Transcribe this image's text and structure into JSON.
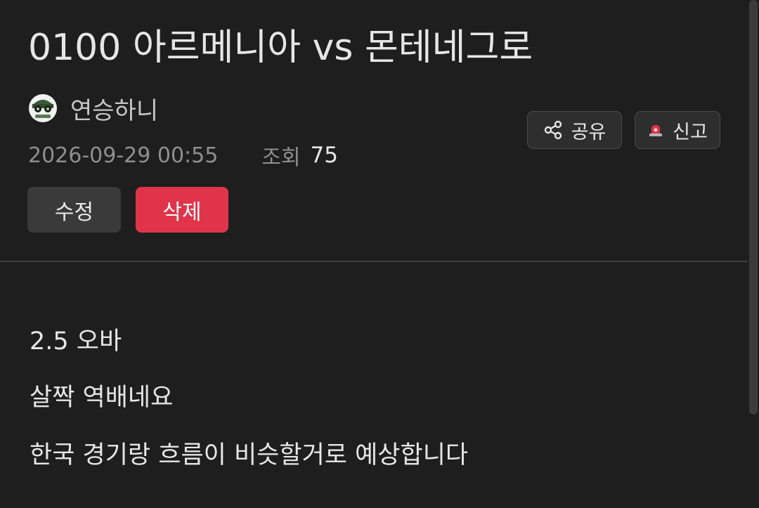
{
  "post": {
    "title": "0100 아르메니아 vs 몬테네그로",
    "author": {
      "name": "연승하니",
      "avatar_icon": "avatar-icon"
    },
    "date": "2026-09-29 00:55",
    "views_label": "조회",
    "views_value": "75",
    "content_lines": [
      "2.5 오바",
      "살짝 역배네요",
      "한국 경기랑 흐름이 비슷할거로 예상합니다"
    ]
  },
  "actions": {
    "edit_label": "수정",
    "delete_label": "삭제",
    "share_label": "공유",
    "share_icon": "share-icon",
    "report_label": "신고",
    "report_icon": "siren-icon"
  },
  "colors": {
    "background": "#1e1e1e",
    "delete_button": "#e0344a",
    "edit_button": "#3a3a3a",
    "muted_text": "#8f8f8f"
  }
}
